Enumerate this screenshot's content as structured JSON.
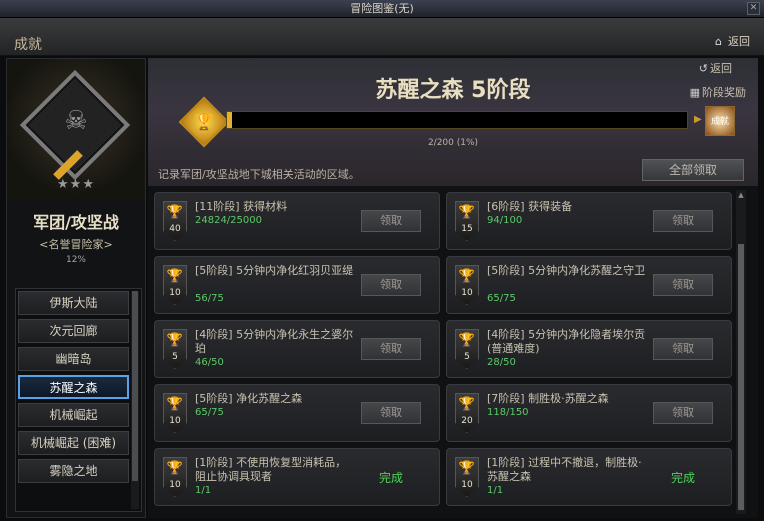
{
  "window": {
    "title": "冒险图鉴(无)",
    "close": "✕"
  },
  "header": {
    "title": "成就",
    "back_label": "返回"
  },
  "category": {
    "title": "军团/攻坚战",
    "subtitle": "<名誉冒险家>",
    "percent": "12%",
    "stars": "★★★"
  },
  "nav": {
    "items": [
      {
        "label": "伊斯大陆"
      },
      {
        "label": "次元回廊"
      },
      {
        "label": "幽暗岛"
      },
      {
        "label": "苏醒之森"
      },
      {
        "label": "机械崛起"
      },
      {
        "label": "机械崛起 (困难)"
      },
      {
        "label": "雾隐之地"
      }
    ],
    "active_index": 3
  },
  "stage": {
    "title": "苏醒之森 5阶段",
    "back_label": "返回",
    "reward_label": "阶段奖励",
    "progress_text": "2/200 (1%)",
    "progress_fraction": 0.01,
    "reward_box_label": "成就",
    "description": "记录军团/攻坚战地下城相关活动的区域。",
    "claim_all": "全部领取"
  },
  "achievements": [
    {
      "points": "40",
      "stage": "[11阶段]",
      "name": "获得材料",
      "progress": "24824/25000",
      "action": "领取",
      "done": false
    },
    {
      "points": "15",
      "stage": "[6阶段]",
      "name": "获得装备",
      "progress": "94/100",
      "action": "领取",
      "done": false
    },
    {
      "points": "10",
      "stage": "[5阶段]",
      "name": "5分钟内净化红羽贝亚缇",
      "progress": "56/75",
      "action": "领取",
      "done": false
    },
    {
      "points": "10",
      "stage": "[5阶段]",
      "name": "5分钟内净化苏醒之守卫",
      "progress": "65/75",
      "action": "领取",
      "done": false
    },
    {
      "points": "5",
      "stage": "[4阶段]",
      "name": "5分钟内净化永生之婆尔珀",
      "progress": "46/50",
      "action": "领取",
      "done": false
    },
    {
      "points": "5",
      "stage": "[4阶段]",
      "name": "5分钟内净化隐者埃尔贡 (普通难度)",
      "progress": "28/50",
      "action": "领取",
      "done": false
    },
    {
      "points": "10",
      "stage": "[5阶段]",
      "name": "净化苏醒之森",
      "progress": "65/75",
      "action": "领取",
      "done": false
    },
    {
      "points": "20",
      "stage": "[7阶段]",
      "name": "制胜极·苏醒之森",
      "progress": "118/150",
      "action": "领取",
      "done": false
    },
    {
      "points": "10",
      "stage": "[1阶段]",
      "name": "不使用恢复型消耗品，阻止协调具现者",
      "progress": "1/1",
      "action": "完成",
      "done": true
    },
    {
      "points": "10",
      "stage": "[1阶段]",
      "name": "过程中不撤退，制胜极·苏醒之森",
      "progress": "1/1",
      "action": "完成",
      "done": true
    }
  ],
  "icons": {
    "home": "home-icon",
    "trophy": "trophy-icon",
    "gift": "gift-icon",
    "back": "back-icon"
  },
  "colors": {
    "accent": "#e6b02c",
    "done": "#4fd25a",
    "active_nav": "#5aa2e8"
  }
}
